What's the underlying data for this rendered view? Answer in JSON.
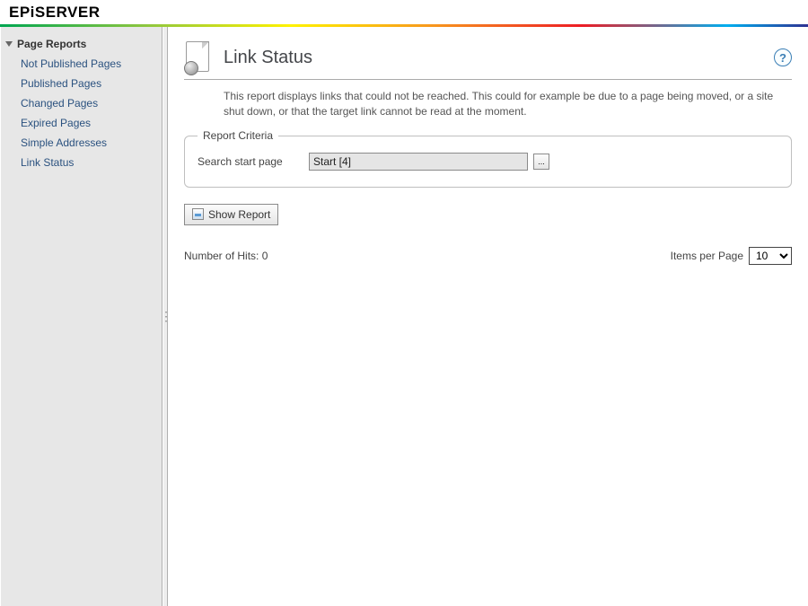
{
  "brand": "EPiSERVER",
  "sidebar": {
    "group_title": "Page Reports",
    "items": [
      "Not Published Pages",
      "Published Pages",
      "Changed Pages",
      "Expired Pages",
      "Simple Addresses",
      "Link Status"
    ]
  },
  "main": {
    "title": "Link Status",
    "help_tooltip": "?",
    "description": "This report displays links that could not be reached. This could for example be due to a page being moved, or a site shut down, or that the target link cannot be read at the moment.",
    "criteria": {
      "legend": "Report Criteria",
      "start_page_label": "Search start page",
      "start_page_value": "Start [4]",
      "browse_label": "..."
    },
    "show_report_label": "Show Report",
    "hits_label": "Number of Hits: 0",
    "items_per_page_label": "Items per Page",
    "items_per_page_value": "10"
  }
}
